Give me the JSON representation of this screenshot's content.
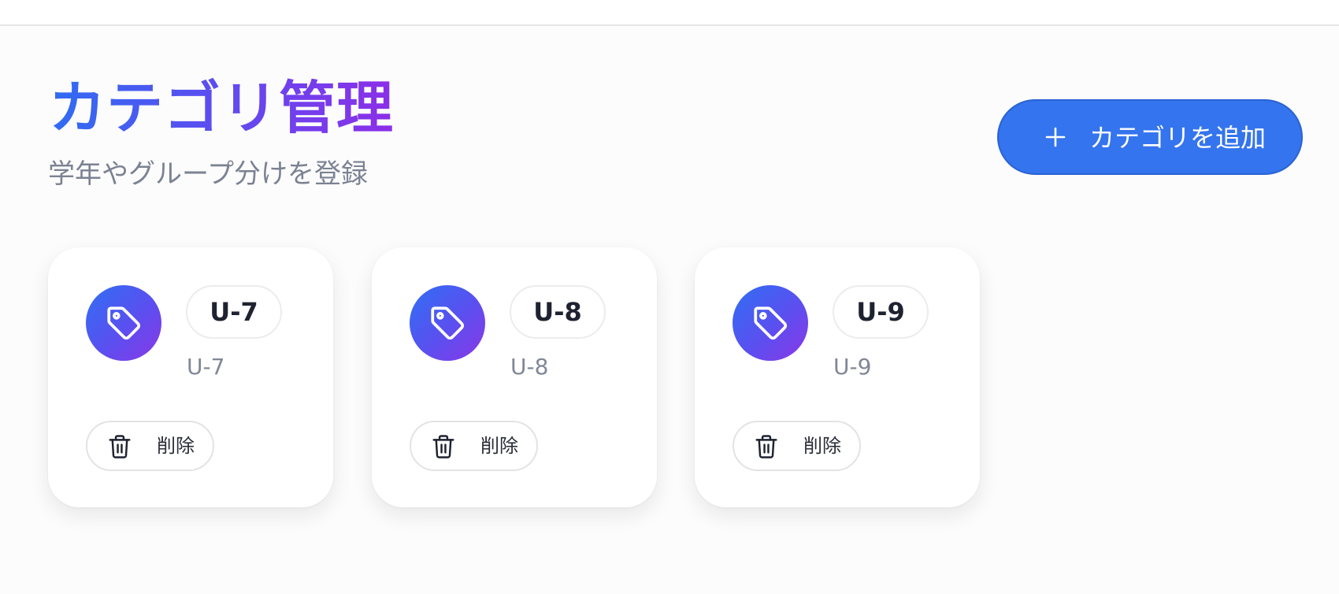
{
  "header": {
    "title": "カテゴリ管理",
    "subtitle": "学年やグループ分けを登録",
    "add_button_label": "カテゴリを追加"
  },
  "categories": [
    {
      "name": "U-7",
      "code": "U-7",
      "delete_label": "削除"
    },
    {
      "name": "U-8",
      "code": "U-8",
      "delete_label": "削除"
    },
    {
      "name": "U-9",
      "code": "U-9",
      "delete_label": "削除"
    }
  ],
  "icons": {
    "add": "plus-icon",
    "category": "tag-icon",
    "delete": "trash-icon"
  },
  "colors": {
    "accent": "#3474ee",
    "gradient_start": "#2f6cf2",
    "gradient_end": "#8b2fe8",
    "subtitle_text": "#7b8292"
  }
}
